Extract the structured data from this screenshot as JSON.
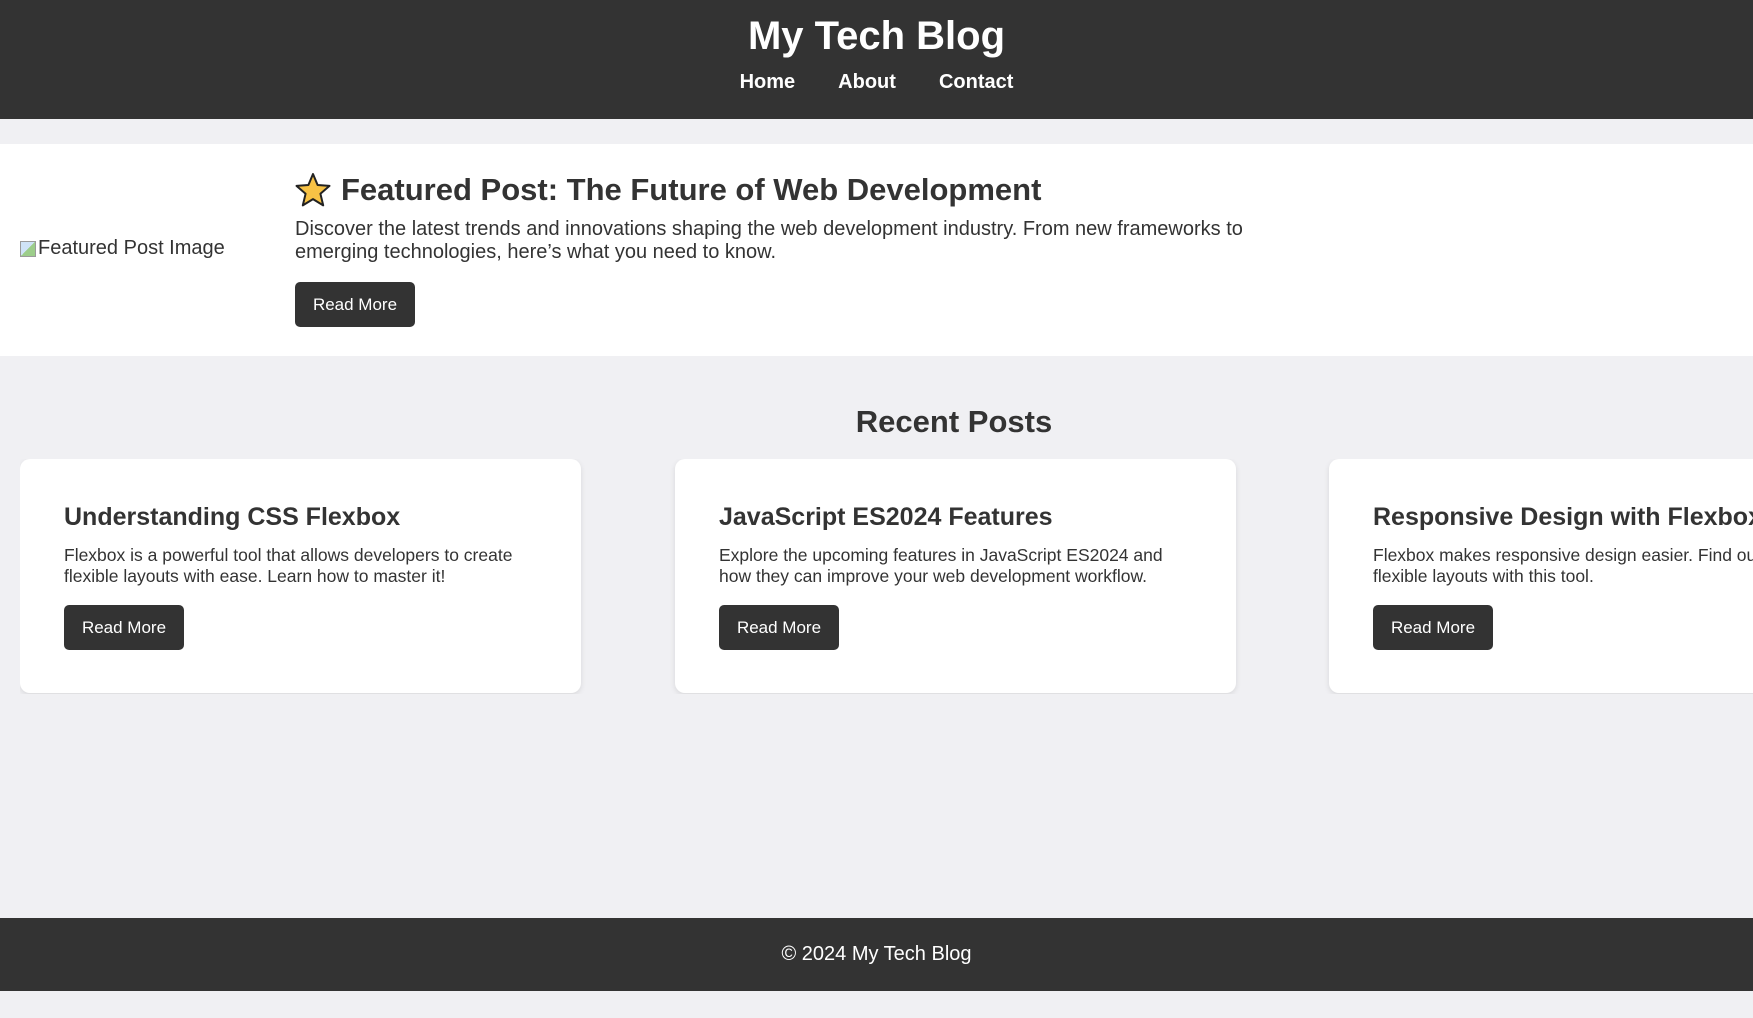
{
  "header": {
    "title": "My Tech Blog",
    "nav": [
      "Home",
      "About",
      "Contact"
    ]
  },
  "featured": {
    "image_alt": "Featured Post Image",
    "icon": "star-icon",
    "title": "Featured Post: The Future of Web Development",
    "excerpt": "Discover the latest trends and innovations shaping the web development industry. From new frameworks to emerging technologies, here’s what you need to know.",
    "button": "Read More"
  },
  "recent": {
    "heading": "Recent Posts",
    "posts": [
      {
        "title": "Understanding CSS Flexbox",
        "excerpt": "Flexbox is a powerful tool that allows developers to create flexible layouts with ease. Learn how to master it!",
        "button": "Read More"
      },
      {
        "title": "JavaScript ES2024 Features",
        "excerpt": "Explore the upcoming features in JavaScript ES2024 and how they can improve your web development workflow.",
        "button": "Read More"
      },
      {
        "title": "Responsive Design with Flexbox",
        "excerpt": "Flexbox makes responsive design easier. Find out how you can build flexible layouts with this tool.",
        "button": "Read More"
      }
    ]
  },
  "footer": {
    "text": "© 2024 My Tech Blog"
  },
  "colors": {
    "header_bg": "#333333",
    "page_bg": "#f0f0f3",
    "card_bg": "#ffffff",
    "button_bg": "#333333",
    "star_fill": "#f7c245"
  }
}
